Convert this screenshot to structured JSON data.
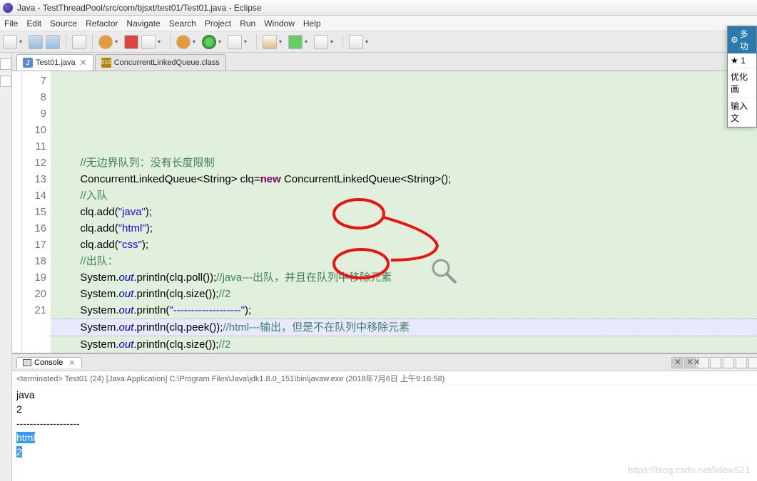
{
  "window": {
    "title": "Java - TestThreadPool/src/com/bjsxt/test01/Test01.java - Eclipse"
  },
  "menu": {
    "items": [
      "File",
      "Edit",
      "Source",
      "Refactor",
      "Navigate",
      "Search",
      "Project",
      "Run",
      "Window",
      "Help"
    ]
  },
  "tabs": {
    "active": {
      "icon": "J",
      "label": "Test01.java"
    },
    "inactive": {
      "icon": "010",
      "label": "ConcurrentLinkedQueue.class"
    }
  },
  "editor": {
    "first_line": 7,
    "lines": [
      {
        "n": 7,
        "indent": "        ",
        "tokens": [
          [
            "cm",
            "//无边界队列：没有长度限制"
          ]
        ]
      },
      {
        "n": 8,
        "indent": "        ",
        "tokens": [
          [
            "",
            "ConcurrentLinkedQueue<String> clq="
          ],
          [
            "kw",
            "new"
          ],
          [
            "",
            " ConcurrentLinkedQueue<String>();"
          ]
        ]
      },
      {
        "n": 9,
        "indent": "        ",
        "tokens": [
          [
            "cm",
            "//入队"
          ]
        ]
      },
      {
        "n": 10,
        "indent": "        ",
        "tokens": [
          [
            "",
            "clq.add("
          ],
          [
            "str",
            "\"java\""
          ],
          [
            "",
            ");"
          ]
        ]
      },
      {
        "n": 11,
        "indent": "        ",
        "tokens": [
          [
            "",
            "clq.add("
          ],
          [
            "str",
            "\"html\""
          ],
          [
            "",
            ");"
          ]
        ]
      },
      {
        "n": 12,
        "indent": "        ",
        "tokens": [
          [
            "",
            "clq.add("
          ],
          [
            "str",
            "\"css\""
          ],
          [
            "",
            ");"
          ]
        ]
      },
      {
        "n": 13,
        "indent": "        ",
        "tokens": [
          [
            "cm",
            "//出队："
          ]
        ]
      },
      {
        "n": 14,
        "indent": "        ",
        "tokens": [
          [
            "",
            "System."
          ],
          [
            "it",
            "out"
          ],
          [
            "",
            ".println(clq.poll());"
          ],
          [
            "cm",
            "//java---出队，并且在队列中移除元素"
          ]
        ]
      },
      {
        "n": 15,
        "indent": "        ",
        "tokens": [
          [
            "",
            "System."
          ],
          [
            "it",
            "out"
          ],
          [
            "",
            ".println(clq.size());"
          ],
          [
            "cm",
            "//2"
          ]
        ]
      },
      {
        "n": 16,
        "indent": "        ",
        "tokens": [
          [
            "",
            "System."
          ],
          [
            "it",
            "out"
          ],
          [
            "",
            ".println("
          ],
          [
            "str",
            "\"-------------------\""
          ],
          [
            "",
            ");"
          ]
        ]
      },
      {
        "n": 17,
        "hl": true,
        "indent": "        ",
        "tokens": [
          [
            "",
            "System."
          ],
          [
            "it",
            "out"
          ],
          [
            "",
            ".println(clq.peek());"
          ],
          [
            "cm",
            "//html---输出，但是不在队列中移除元素"
          ]
        ]
      },
      {
        "n": 18,
        "indent": "        ",
        "tokens": [
          [
            "",
            "System."
          ],
          [
            "it",
            "out"
          ],
          [
            "",
            ".println(clq.size());"
          ],
          [
            "cm",
            "//2"
          ]
        ]
      },
      {
        "n": 19,
        "indent": "",
        "tokens": []
      },
      {
        "n": 20,
        "indent": "",
        "tokens": []
      },
      {
        "n": 21,
        "indent": "",
        "tokens": []
      }
    ]
  },
  "console": {
    "tab_label": "Console",
    "header": "<terminated> Test01 (24) [Java Application] C:\\Program Files\\Java\\jdk1.8.0_151\\bin\\javaw.exe (2018年7月6日 上午9:16:58)",
    "lines": [
      {
        "text": "java",
        "sel": false
      },
      {
        "text": "2",
        "sel": false
      },
      {
        "text": "-------------------",
        "sel": false
      },
      {
        "text": "html",
        "sel": true
      },
      {
        "text": "2",
        "sel": true
      }
    ]
  },
  "floating": {
    "title": "多功",
    "star": "★ 1",
    "items": [
      "优化画",
      "输入文"
    ]
  },
  "watermark": "https://blog.csdn.net/lidew521"
}
